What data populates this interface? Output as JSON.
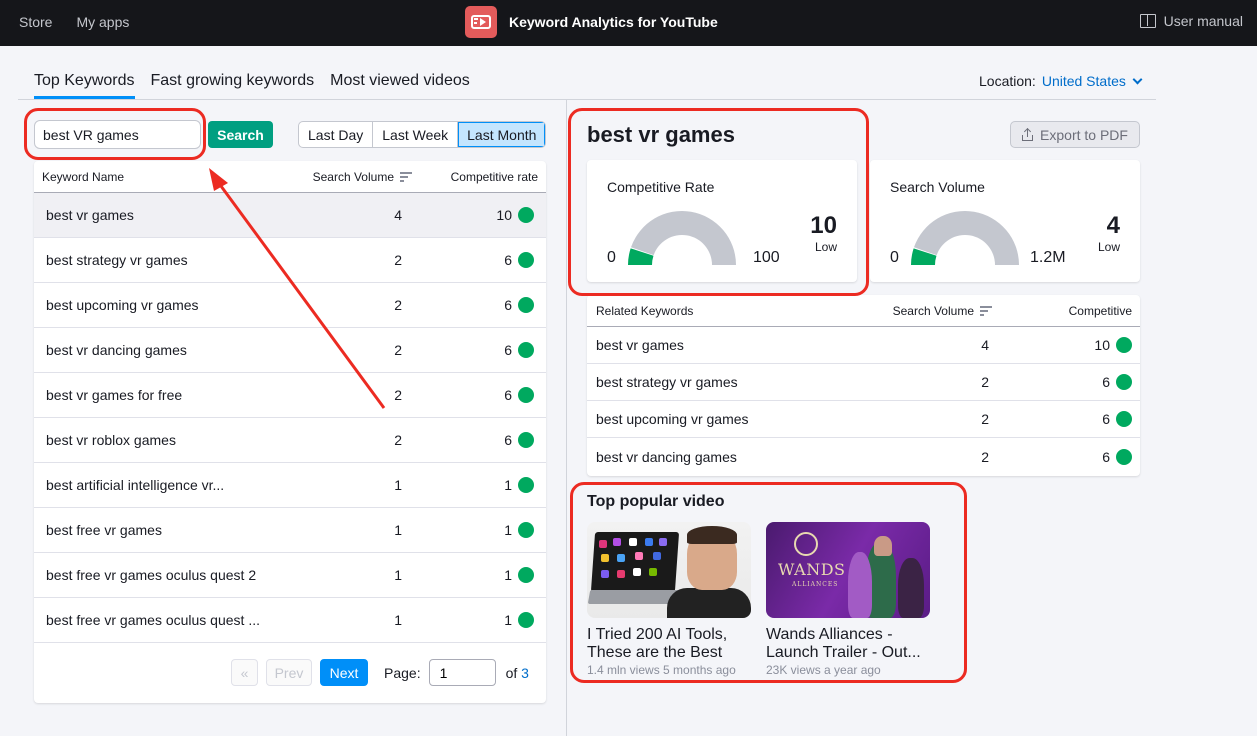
{
  "topbar": {
    "nav": [
      "Store",
      "My apps"
    ],
    "app_title": "Keyword Analytics for YouTube",
    "user_manual": "User manual"
  },
  "tabs": [
    {
      "label": "Top Keywords",
      "active": true
    },
    {
      "label": "Fast growing keywords",
      "active": false
    },
    {
      "label": "Most viewed videos",
      "active": false
    }
  ],
  "location": {
    "label": "Location:",
    "value": "United States"
  },
  "search": {
    "value": "best VR games",
    "button": "Search"
  },
  "date_range": {
    "options": [
      "Last Day",
      "Last Week",
      "Last Month"
    ],
    "selected": "Last Month"
  },
  "keywords_table": {
    "headers": {
      "name": "Keyword Name",
      "volume": "Search Volume",
      "competitive": "Competitive rate"
    },
    "rows": [
      {
        "name": "best vr games",
        "volume": "4",
        "competitive": "10",
        "highlighted": true
      },
      {
        "name": "best strategy vr games",
        "volume": "2",
        "competitive": "6"
      },
      {
        "name": "best upcoming vr games",
        "volume": "2",
        "competitive": "6"
      },
      {
        "name": "best vr dancing games",
        "volume": "2",
        "competitive": "6"
      },
      {
        "name": "best vr games for free",
        "volume": "2",
        "competitive": "6"
      },
      {
        "name": "best vr roblox games",
        "volume": "2",
        "competitive": "6"
      },
      {
        "name": "best artificial intelligence vr...",
        "volume": "1",
        "competitive": "1"
      },
      {
        "name": "best free vr games",
        "volume": "1",
        "competitive": "1"
      },
      {
        "name": "best free vr games oculus quest 2",
        "volume": "1",
        "competitive": "1"
      },
      {
        "name": "best free vr games oculus quest ...",
        "volume": "1",
        "competitive": "1"
      }
    ],
    "status_color": "#00a95f"
  },
  "pagination": {
    "first": "«",
    "prev": "Prev",
    "next": "Next",
    "page_label": "Page:",
    "page": "1",
    "of_label": "of",
    "total": "3"
  },
  "detail": {
    "keyword": "best vr games",
    "export": "Export to PDF",
    "competitive_rate": {
      "title": "Competitive Rate",
      "min": "0",
      "max": "100",
      "value": "10",
      "level": "Low",
      "fraction": 0.1
    },
    "search_volume": {
      "title": "Search Volume",
      "min": "0",
      "max": "1.2M",
      "value": "4",
      "level": "Low",
      "fraction": 0.1
    }
  },
  "related_table": {
    "headers": {
      "name": "Related Keywords",
      "volume": "Search Volume",
      "competitive": "Competitive"
    },
    "rows": [
      {
        "name": "best vr games",
        "volume": "4",
        "competitive": "10"
      },
      {
        "name": "best strategy vr games",
        "volume": "2",
        "competitive": "6"
      },
      {
        "name": "best upcoming vr games",
        "volume": "2",
        "competitive": "6"
      },
      {
        "name": "best vr dancing games",
        "volume": "2",
        "competitive": "6"
      }
    ]
  },
  "popular": {
    "title": "Top popular video",
    "videos": [
      {
        "title_line1": "I Tried 200 AI Tools,",
        "title_line2": "These are the Best",
        "meta": "1.4 mln views 5 months ago"
      },
      {
        "title_line1": "Wands Alliances -",
        "title_line2": "Launch Trailer - Out...",
        "meta": "23K views a year ago",
        "thumb_text": "WANDS",
        "thumb_sub": "ALLIANCES"
      }
    ]
  },
  "colors": {
    "accent": "#008ff8",
    "search_button": "#009f81",
    "annotation": "#ec2b22",
    "gauge_fill": "#00a95f",
    "gauge_track": "#c4c7cf"
  }
}
